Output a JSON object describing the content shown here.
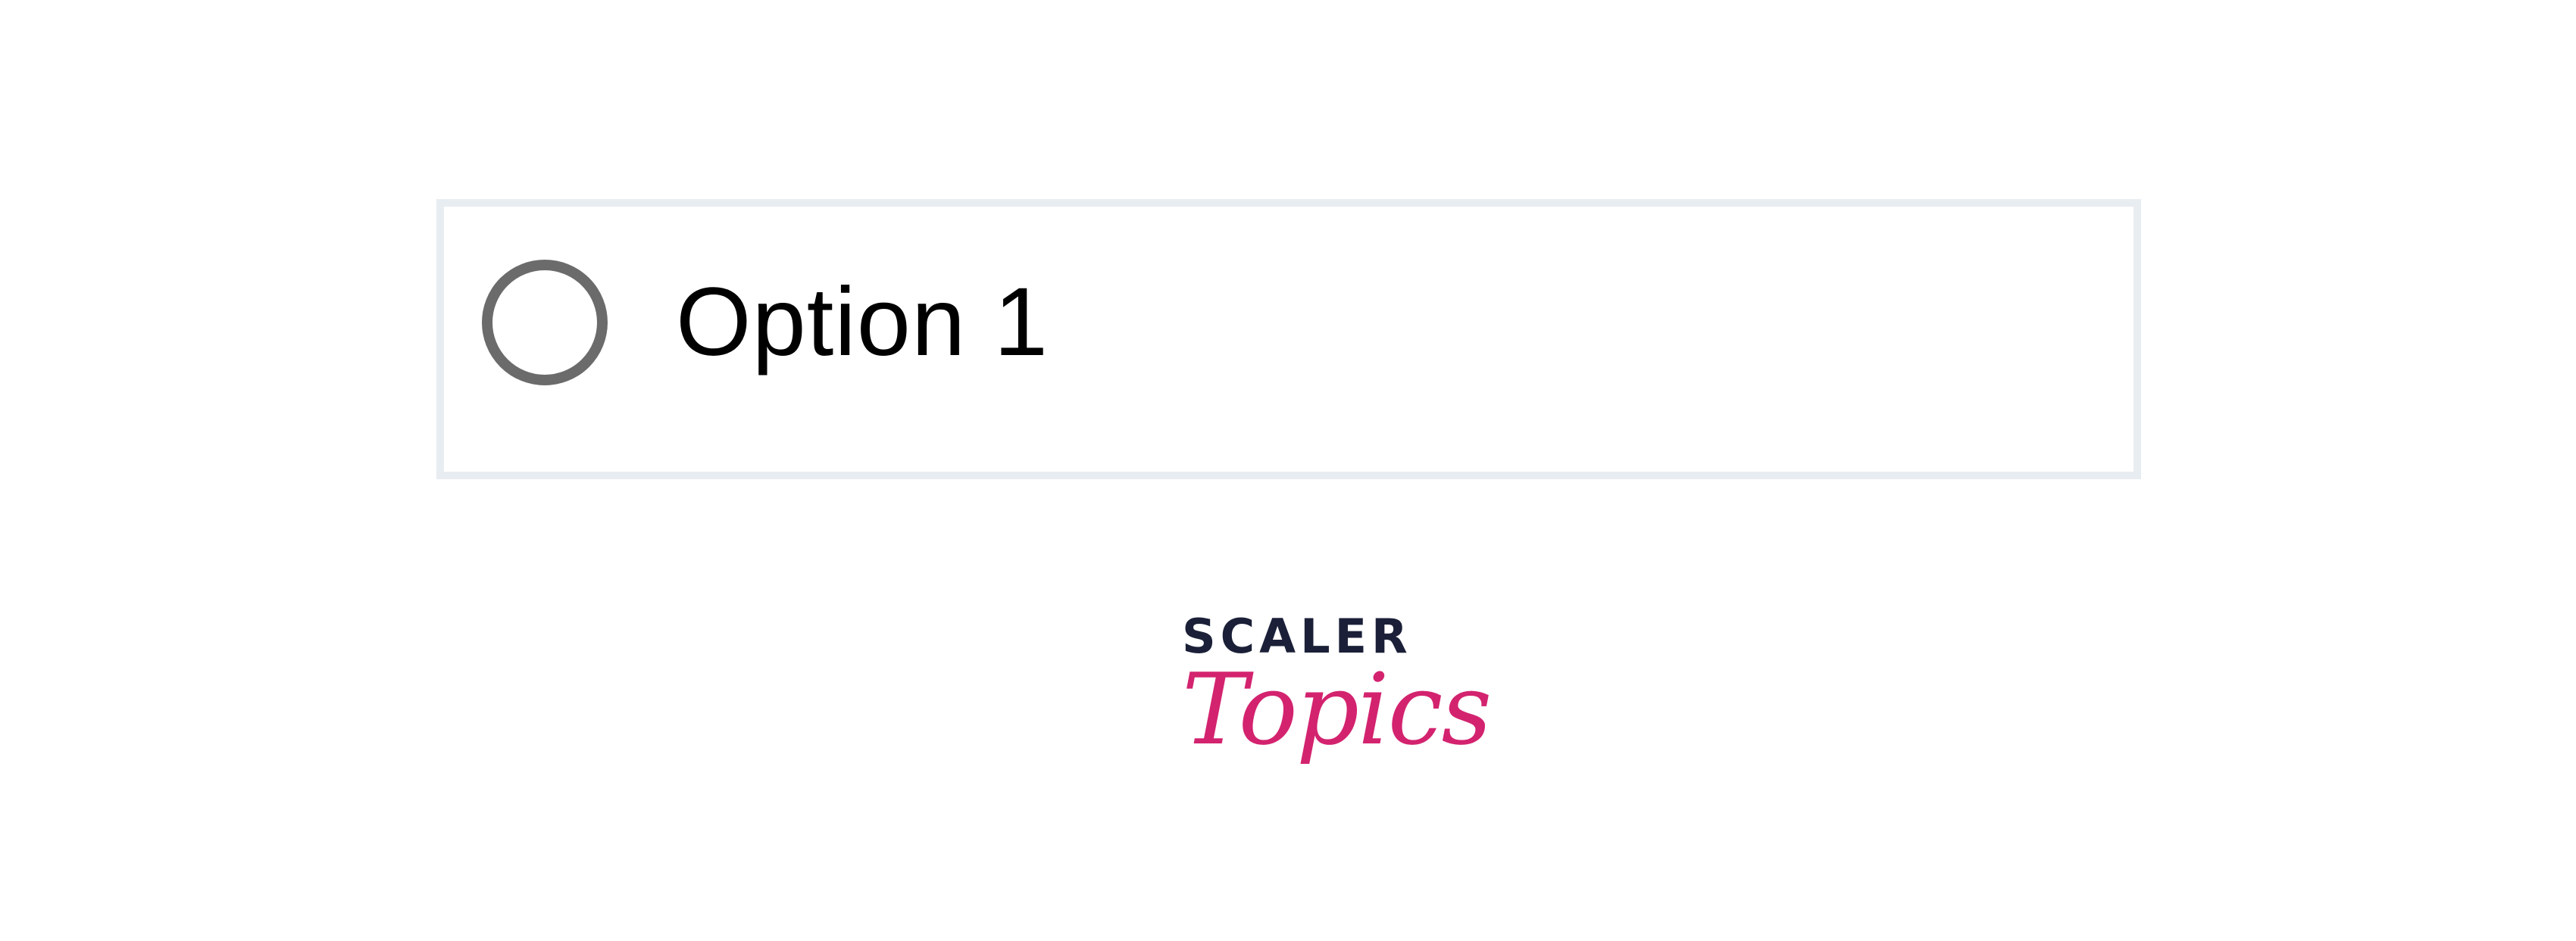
{
  "option": {
    "label": "Option 1",
    "checked": false
  },
  "logo": {
    "top_text": "SCALER",
    "bottom_text": "Topics"
  },
  "colors": {
    "card_border": "#e8edf2",
    "radio_border": "#6b6b6b",
    "logo_dark": "#1b2038",
    "logo_accent": "#d3236f"
  }
}
